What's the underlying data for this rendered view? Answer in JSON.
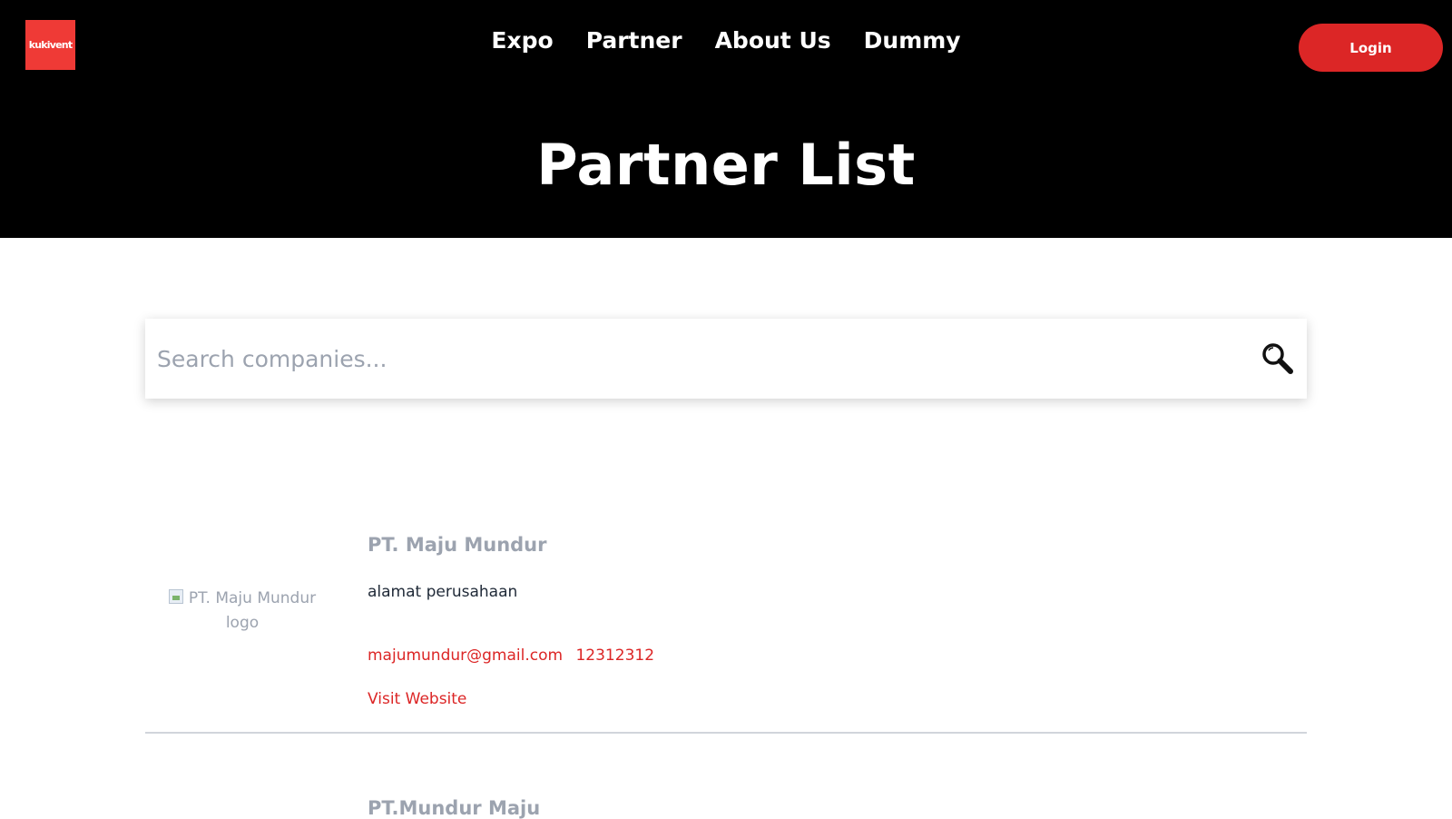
{
  "brand": {
    "logo_text": "kukivent",
    "accent": "#dc2626"
  },
  "nav": {
    "items": [
      {
        "label": "Expo"
      },
      {
        "label": "Partner"
      },
      {
        "label": "About Us"
      },
      {
        "label": "Dummy"
      }
    ],
    "login_label": "Login"
  },
  "page": {
    "title": "Partner List"
  },
  "search": {
    "placeholder": "Search companies...",
    "icon": "search-icon"
  },
  "partners": [
    {
      "name": "PT. Maju Mundur",
      "logo_alt": "PT. Maju Mundur logo",
      "address": "alamat perusahaan",
      "email": "majumundur@gmail.com",
      "phone": "12312312",
      "website_label": "Visit Website"
    },
    {
      "name": "PT.Mundur Maju"
    }
  ]
}
